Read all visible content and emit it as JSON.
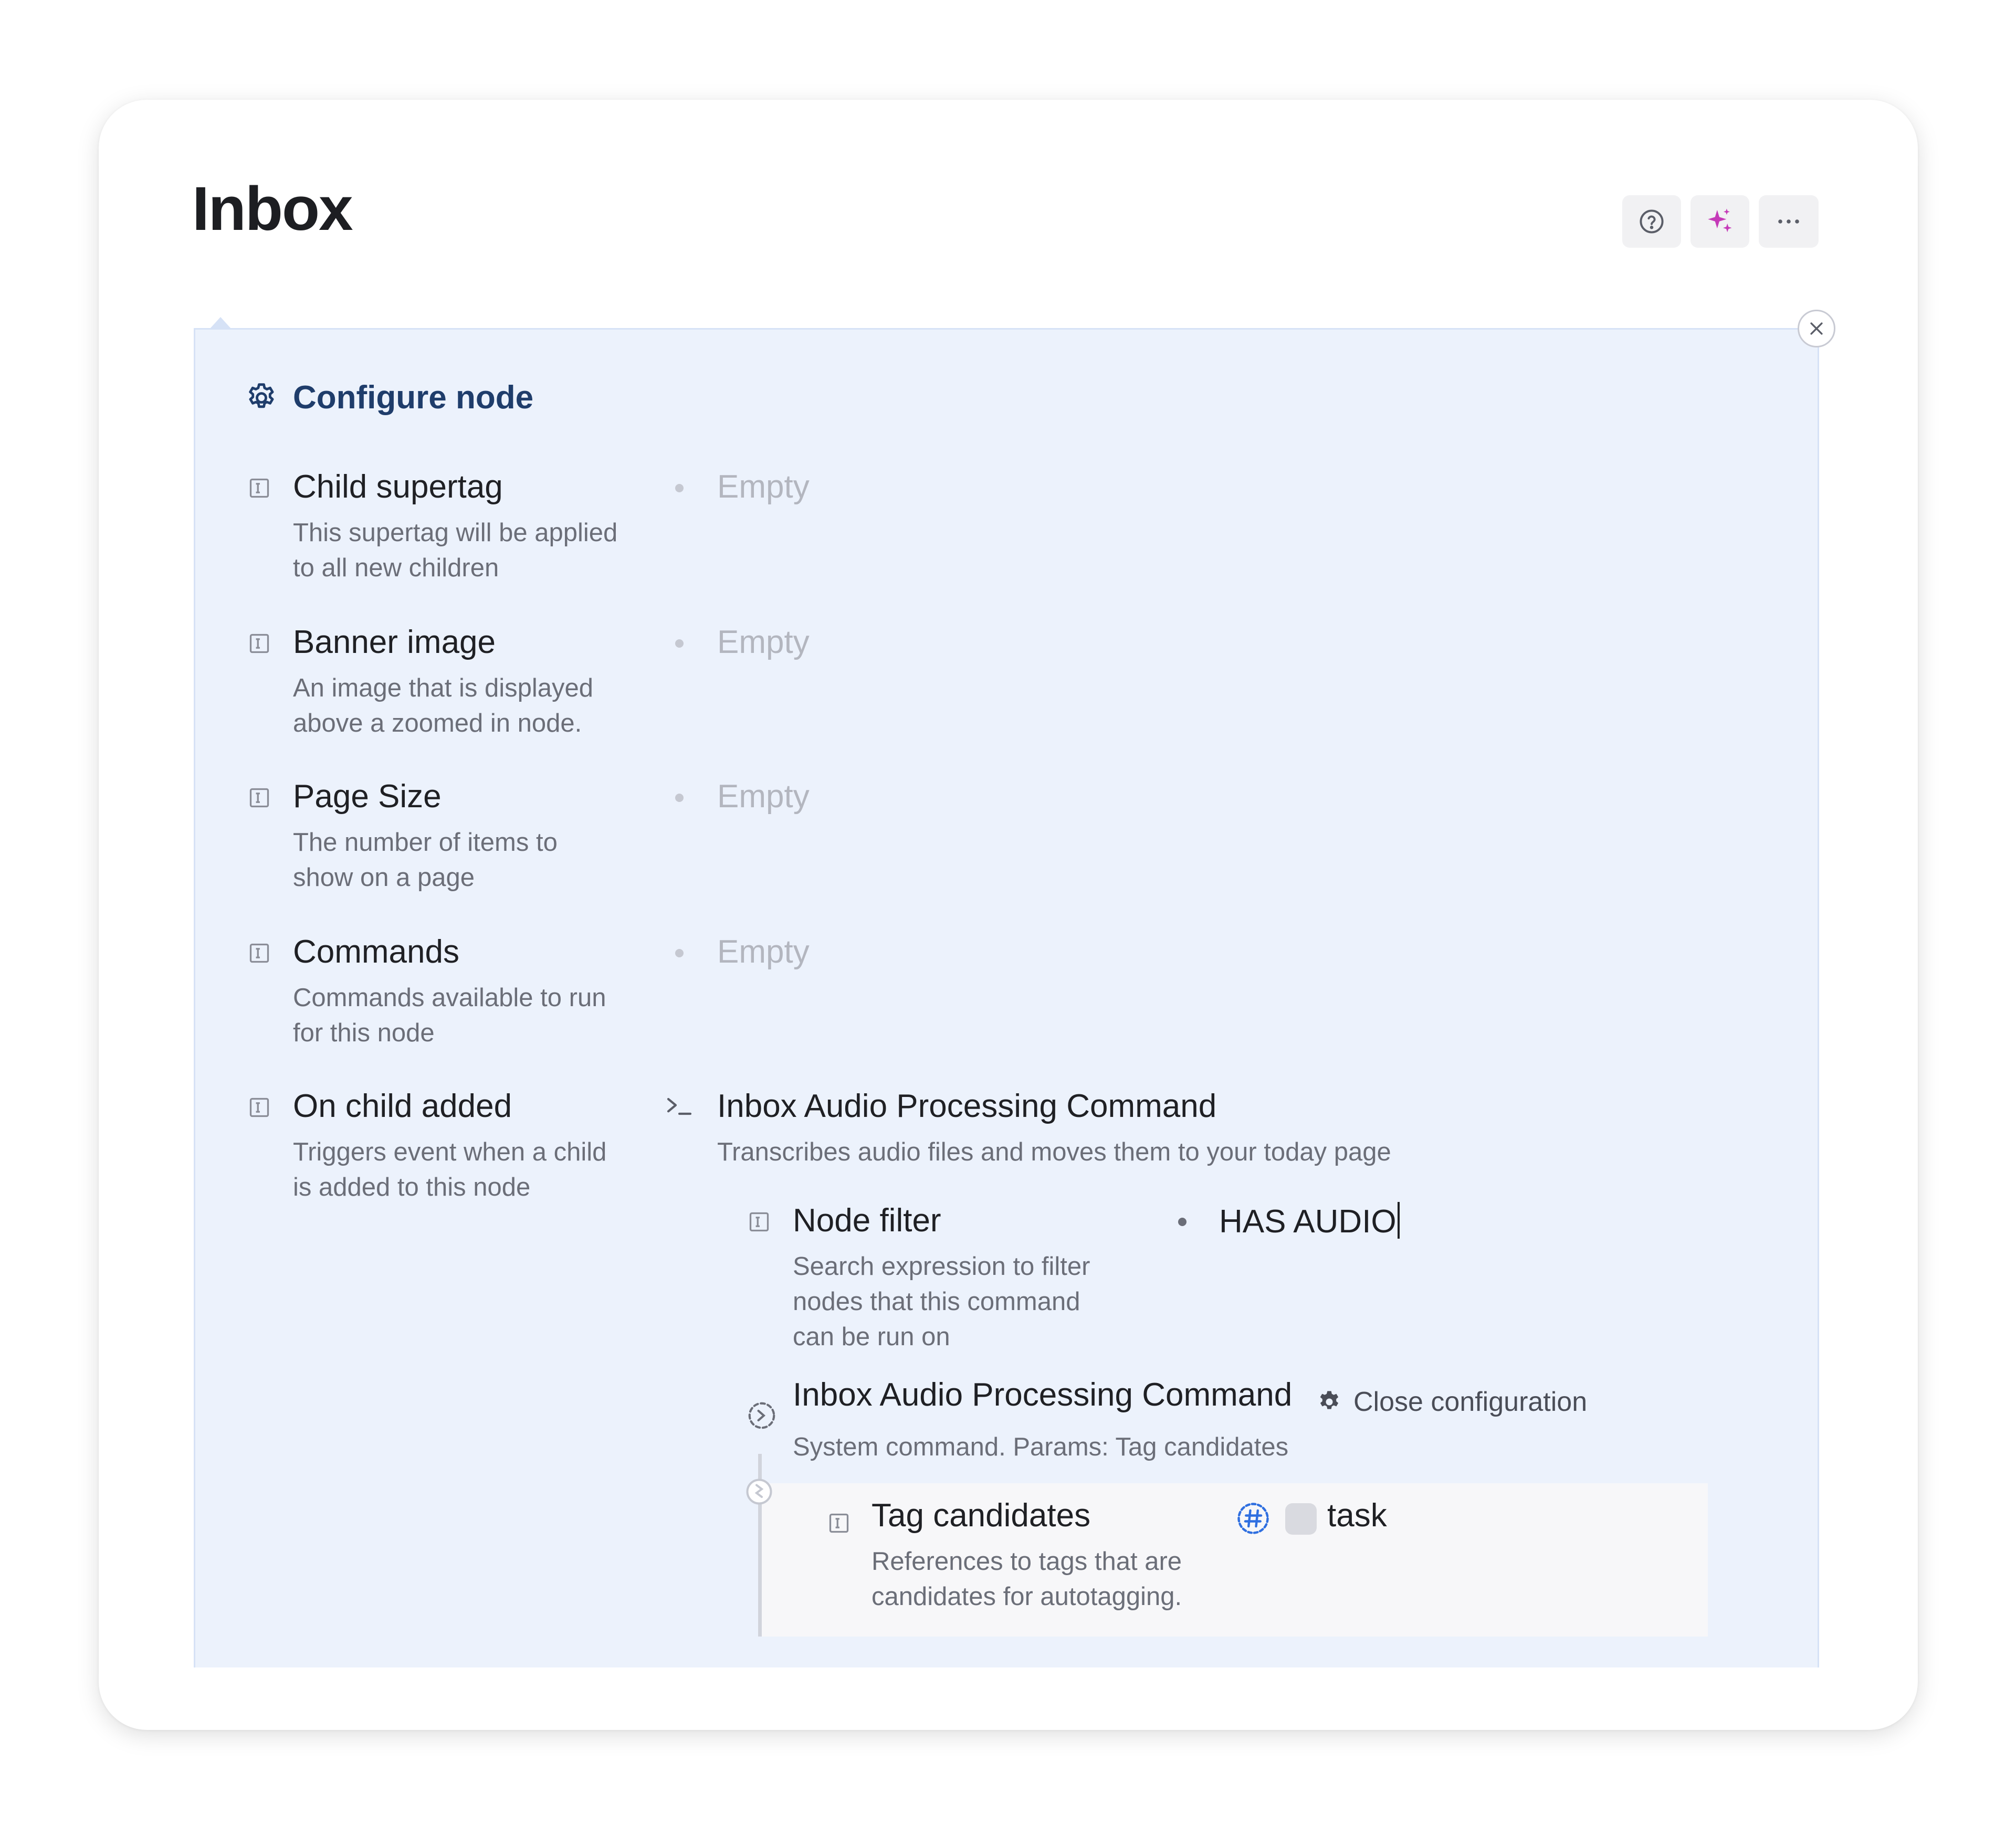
{
  "page": {
    "title": "Inbox"
  },
  "toolbar": {
    "help_icon": "help-circle-icon",
    "ai_icon": "sparkle-icon",
    "more_icon": "more-horizontal-icon"
  },
  "config": {
    "title": "Configure node",
    "icon": "gear-icon",
    "fields": [
      {
        "label": "Child supertag",
        "desc_line1": "This supertag will be applied",
        "desc_line2": "to all new children",
        "value": "Empty"
      },
      {
        "label": "Banner image",
        "desc_line1": "An image that is displayed",
        "desc_line2": "above a zoomed in node.",
        "value": "Empty"
      },
      {
        "label": "Page Size",
        "desc_line1": "The number of items to",
        "desc_line2": "show on a page",
        "value": "Empty"
      },
      {
        "label": "Commands",
        "desc_line1": "Commands available to run",
        "desc_line2": "for this node",
        "value": "Empty"
      },
      {
        "label": "On child added",
        "desc_line1": "Triggers event when a child",
        "desc_line2": "is added to this node"
      }
    ],
    "command": {
      "name": "Inbox Audio Processing Command",
      "description": "Transcribes audio files and moves them to your today page",
      "node_filter": {
        "label": "Node filter",
        "desc_line1": "Search expression to filter",
        "desc_line2": "nodes that this command",
        "desc_line3": "can be run on",
        "value": "HAS AUDIO"
      },
      "system_command": {
        "name": "Inbox Audio Processing Command",
        "close_label": "Close configuration",
        "description": "System command. Params: Tag candidates"
      },
      "tag_candidates": {
        "label": "Tag candidates",
        "desc_line1": "References to tags that are",
        "desc_line2": "candidates for autotagging.",
        "tag": "task"
      }
    }
  },
  "colors": {
    "panel_bg": "#ecf2fc",
    "config_title": "#1f3d6b",
    "ai_accent": "#c53ab8",
    "tag_icon": "#2f6fe0"
  }
}
